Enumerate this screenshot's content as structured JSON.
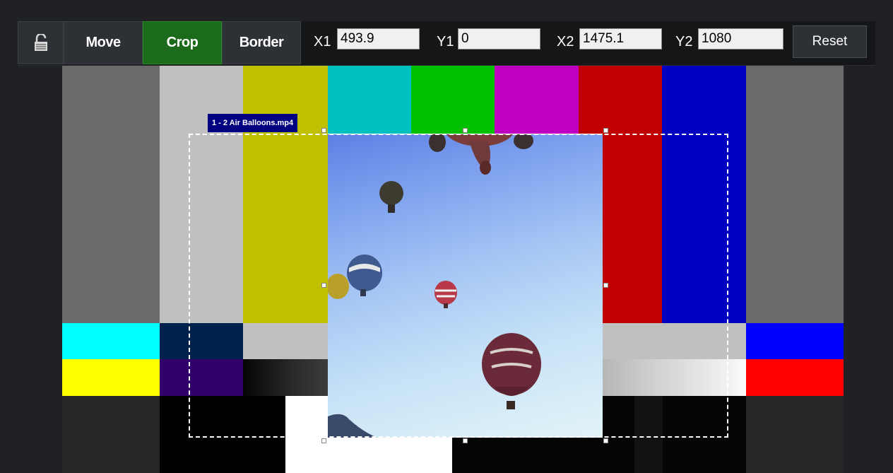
{
  "toolbar": {
    "lock_icon": "unlocked-padlock-icon",
    "move_label": "Move",
    "crop_label": "Crop",
    "border_label": "Border",
    "active_mode": "Crop",
    "x1_label": "X1",
    "x1_value": "493.9",
    "y1_label": "Y1",
    "y1_value": "0",
    "x2_label": "X2",
    "x2_value": "1475.1",
    "y2_label": "Y2",
    "y2_value": "1080",
    "reset_label": "Reset"
  },
  "preview": {
    "source_label": "1 - 2 Air Balloons.mp4",
    "background": "SMPTE color bars test pattern"
  },
  "colors": {
    "active_button": "#1c6b1c",
    "toolbar_bg": "#141618",
    "selection_dash": "#ffffff",
    "source_tag_bg": "#000080"
  }
}
